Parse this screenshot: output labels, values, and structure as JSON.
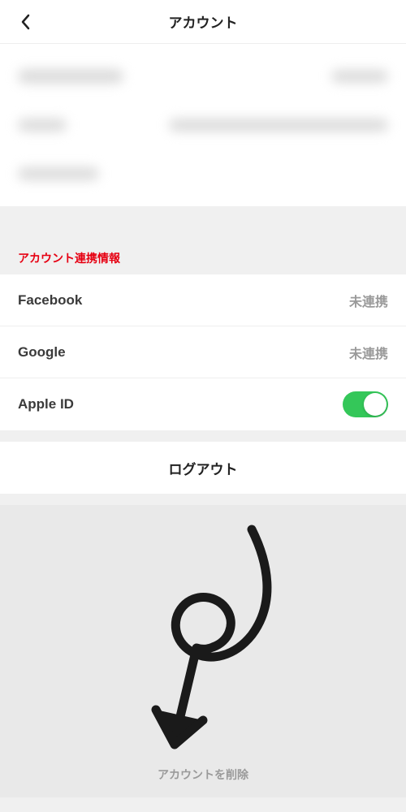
{
  "header": {
    "title": "アカウント"
  },
  "linked_accounts": {
    "section_label": "アカウント連携情報",
    "items": [
      {
        "name": "Facebook",
        "status": "未連携",
        "linked": false
      },
      {
        "name": "Google",
        "status": "未連携",
        "linked": false
      },
      {
        "name": "Apple ID",
        "status": "",
        "linked": true
      }
    ]
  },
  "actions": {
    "logout": "ログアウト",
    "delete_account": "アカウントを削除"
  }
}
